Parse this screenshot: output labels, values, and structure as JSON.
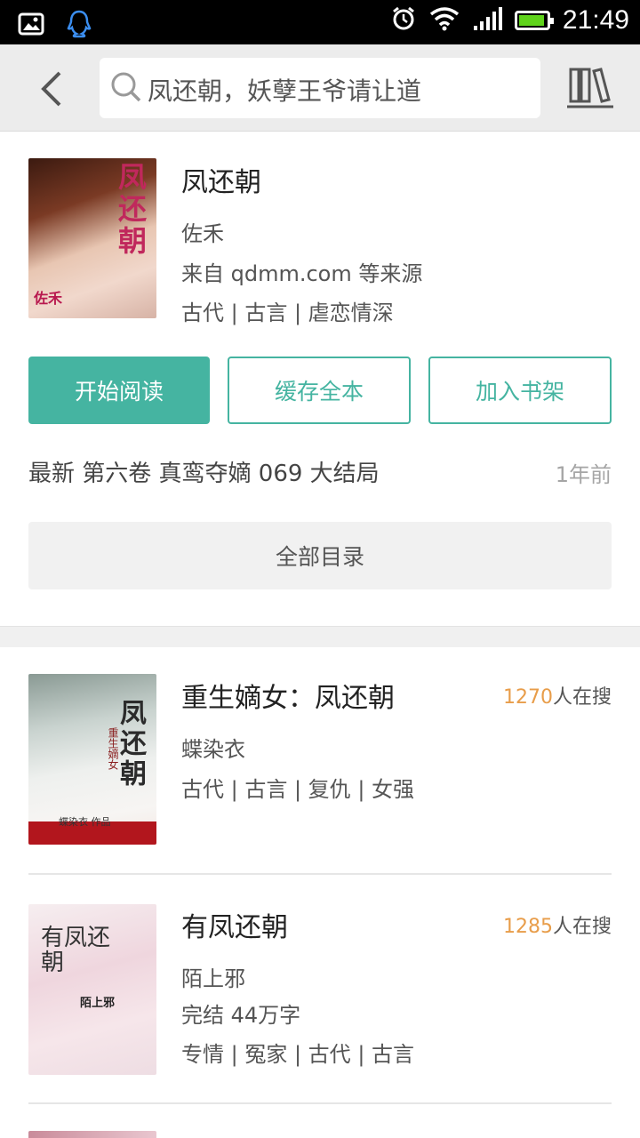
{
  "status_bar": {
    "time": "21:49",
    "icons": [
      "image-icon",
      "qq-icon",
      "alarm-icon",
      "wifi-icon",
      "signal-icon",
      "battery-icon"
    ]
  },
  "header": {
    "search_text": "凤还朝，妖孽王爷请让道",
    "icons": [
      "back-icon",
      "search-icon",
      "bookshelf-icon"
    ]
  },
  "book": {
    "title": "凤还朝",
    "author": "佐禾",
    "source": "来自 qdmm.com 等来源",
    "tags": "古代 | 古言 | 虐恋情深",
    "cover_text": "凤还朝",
    "cover_author": "佐禾",
    "actions": {
      "read": "开始阅读",
      "cache": "缓存全本",
      "add_shelf": "加入书架"
    },
    "latest": "最新 第六卷 真鸾夺嫡 069 大结局",
    "latest_time": "1年前",
    "toc": "全部目录"
  },
  "related": [
    {
      "title": "重生嫡女：凤还朝",
      "count": "1270",
      "count_suffix": "人在搜",
      "author": "蝶染衣",
      "tags": "古代 | 古言 | 复仇 | 女强",
      "cover_text": "凤还朝",
      "cover_sub": "重生嫡女",
      "cover_author": "蝶染衣 作品"
    },
    {
      "title": "有凤还朝",
      "count": "1285",
      "count_suffix": "人在搜",
      "author": "陌上邪",
      "status": "完结  44万字",
      "tags": "专情 | 冤家 | 古代 | 古言",
      "cover_text": "有凤还朝",
      "cover_author": "陌上邪"
    }
  ],
  "colors": {
    "accent": "#45b4a1",
    "count_highlight": "#e89d4a",
    "header_bg": "#ececec"
  }
}
